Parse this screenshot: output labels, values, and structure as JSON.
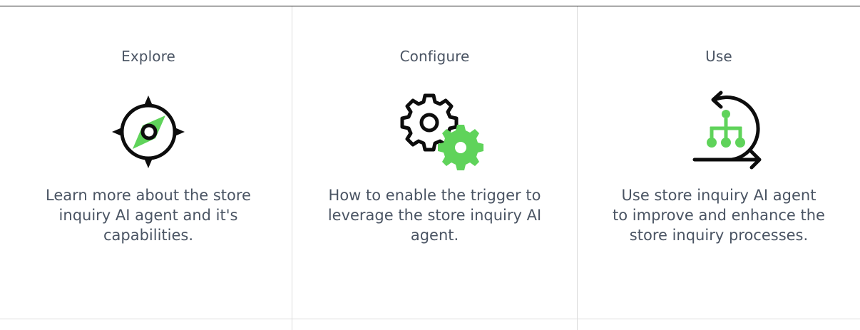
{
  "colors": {
    "accent": "#5fd35a",
    "icon_stroke": "#0d0d0d",
    "text": "#4a5463",
    "divider": "#dcdcdc"
  },
  "cards": [
    {
      "title": "Explore",
      "icon": "compass-icon",
      "text": "Learn more about the store inquiry AI agent and it's capabilities."
    },
    {
      "title": "Configure",
      "icon": "gears-icon",
      "text": "How to enable the trigger to leverage the store inquiry AI agent."
    },
    {
      "title": "Use",
      "icon": "cycle-hierarchy-icon",
      "text": "Use store inquiry AI agent to improve and enhance the store inquiry processes."
    }
  ]
}
